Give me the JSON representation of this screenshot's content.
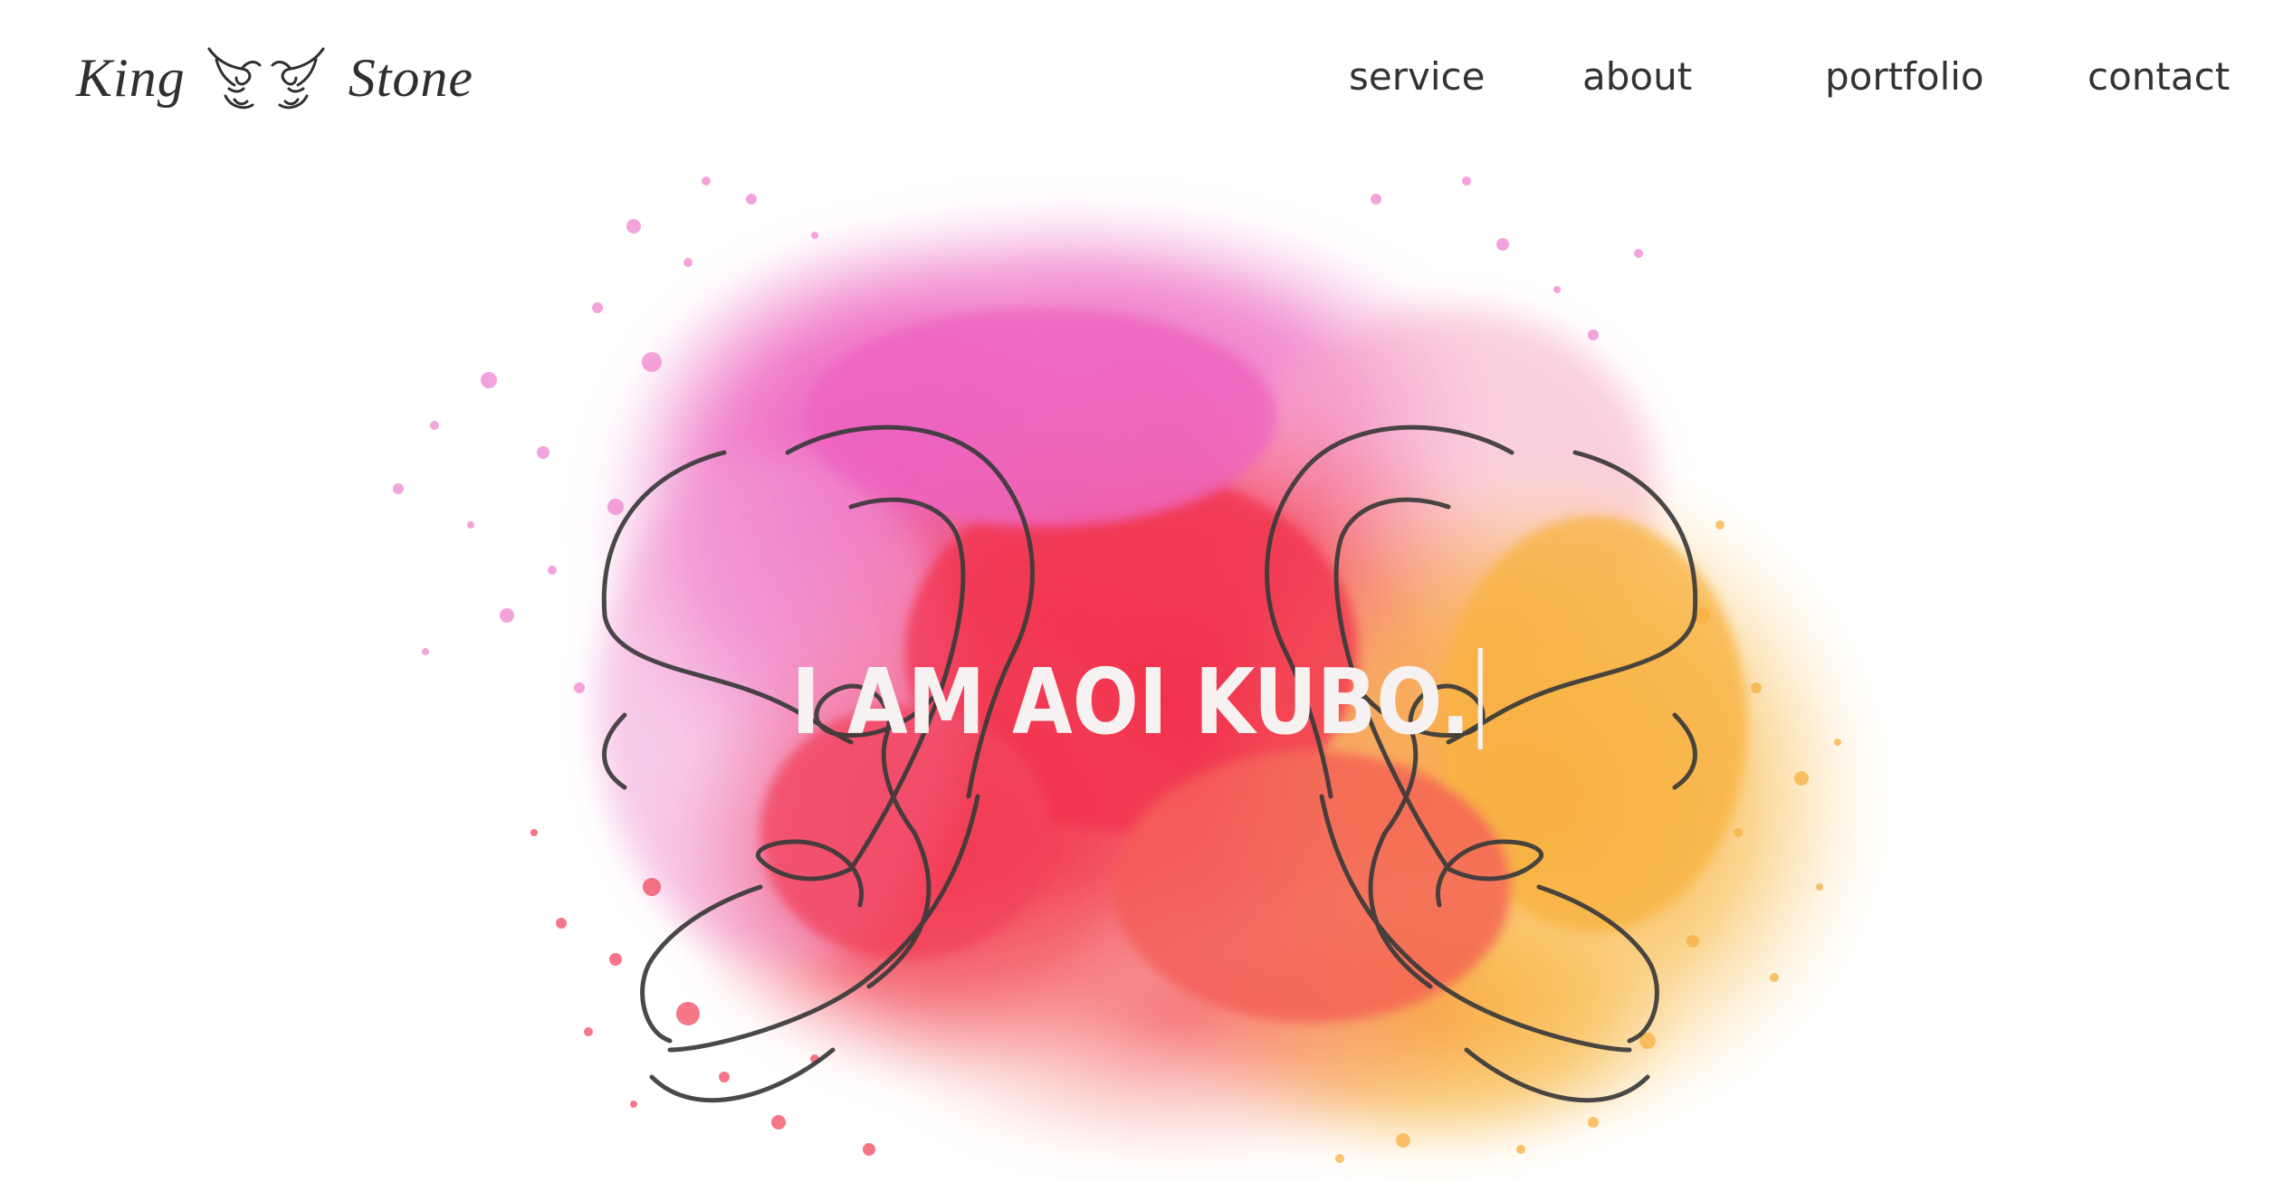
{
  "header": {
    "logo": {
      "left_word": "King",
      "right_word": "Stone",
      "mark_icon": "paired-horned-figures-logo-icon",
      "text_color": "#2f2f2f"
    },
    "nav": [
      {
        "label": "service"
      },
      {
        "label": "about"
      },
      {
        "label": "portfolio"
      },
      {
        "label": "contact"
      }
    ],
    "nav_color": "#333333"
  },
  "hero": {
    "title": "I AM AOI KUBO.",
    "title_color": "#f6f2f2",
    "cursor_icon": "text-caret-icon",
    "background_art": "watercolor-splash-with-paired-line-figures",
    "colors": {
      "pink": "#ec5cbf",
      "red": "#f0344f",
      "orange": "#f8b43c",
      "line": "#3a3a3a"
    }
  }
}
